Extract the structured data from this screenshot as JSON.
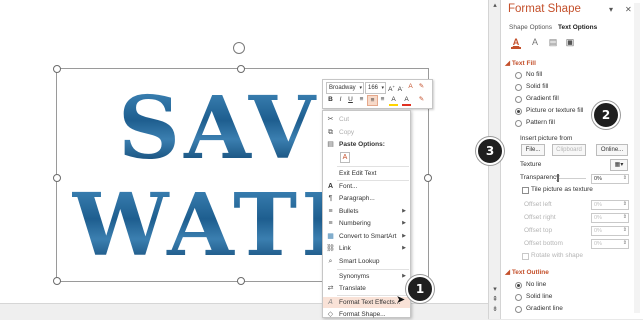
{
  "slide": {
    "line1": "SAVE",
    "line2": "WATER"
  },
  "mini_toolbar": {
    "font": "Broadway",
    "size": "166",
    "buttons": [
      "B",
      "I",
      "U",
      "≡",
      "≡",
      "≡",
      "A",
      "A",
      "✎"
    ]
  },
  "context_menu": [
    {
      "icon": "cut-icon",
      "glyph": "✂",
      "label": "Cut",
      "disabled": true
    },
    {
      "icon": "copy-icon",
      "glyph": "⧉",
      "label": "Copy",
      "disabled": true
    },
    {
      "icon": "paste-icon",
      "glyph": "📋",
      "label": "Paste Options:",
      "bold": true
    },
    {
      "icon": "paste-keep-text-icon",
      "glyph": "A",
      "label": ""
    },
    {
      "icon": "",
      "glyph": "",
      "label": "Exit Edit Text"
    },
    {
      "icon": "font-icon",
      "glyph": "A",
      "label": "Font..."
    },
    {
      "icon": "paragraph-icon",
      "glyph": "¶",
      "label": "Paragraph..."
    },
    {
      "icon": "bullets-icon",
      "glyph": "≡",
      "label": "Bullets",
      "submenu": true
    },
    {
      "icon": "numbering-icon",
      "glyph": "≡",
      "label": "Numbering",
      "submenu": true
    },
    {
      "icon": "smartart-icon",
      "glyph": "▦",
      "label": "Convert to SmartArt",
      "submenu": true
    },
    {
      "icon": "link-icon",
      "glyph": "⛓",
      "label": "Link",
      "submenu": true
    },
    {
      "icon": "smart-lookup-icon",
      "glyph": "⌕",
      "label": "Smart Lookup"
    },
    {
      "icon": "",
      "glyph": "",
      "label": "Synonyms",
      "submenu": true
    },
    {
      "icon": "translate-icon",
      "glyph": "⇄",
      "label": "Translate"
    },
    {
      "icon": "text-effects-icon",
      "glyph": "A",
      "label": "Format Text Effects...",
      "highlighted": true
    },
    {
      "icon": "format-shape-icon",
      "glyph": "◇",
      "label": "Format Shape..."
    }
  ],
  "panel": {
    "title": "Format Shape",
    "pin": "▾",
    "close": "✕",
    "tab_shape": "Shape Options",
    "tab_text": "Text Options",
    "text_fill_section": "Text Fill",
    "fill_options": [
      "No fill",
      "Solid fill",
      "Gradient fill",
      "Picture or texture fill",
      "Pattern fill"
    ],
    "fill_selected": 3,
    "insert_picture_from": "Insert picture from",
    "btn_file": "File...",
    "btn_clipboard": "Clipboard",
    "btn_online": "Online...",
    "texture": "Texture",
    "transparency": "Transparency",
    "transparency_value": "0%",
    "tile_label": "Tile picture as texture",
    "offsets": [
      {
        "label": "Offset left",
        "value": "0%"
      },
      {
        "label": "Offset right",
        "value": "0%"
      },
      {
        "label": "Offset top",
        "value": "0%"
      },
      {
        "label": "Offset bottom",
        "value": "0%"
      }
    ],
    "rotate_with_shape": "Rotate with shape",
    "text_outline_section": "Text Outline",
    "outline_options": [
      "No line",
      "Solid line",
      "Gradient line"
    ],
    "outline_selected": 0
  },
  "callouts": [
    "1",
    "2",
    "3"
  ],
  "colors": {
    "accent": "#c4502b",
    "text_fill": "#1f5f8e"
  }
}
